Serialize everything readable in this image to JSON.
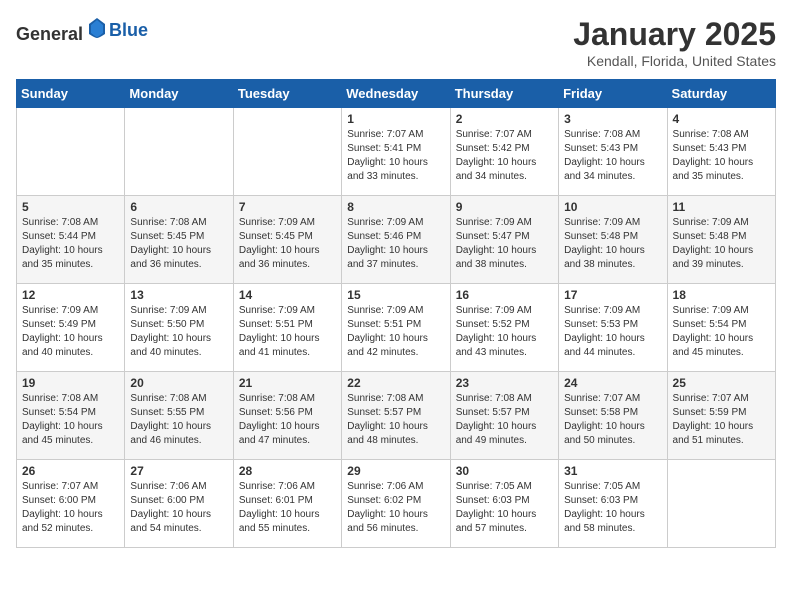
{
  "header": {
    "logo_general": "General",
    "logo_blue": "Blue",
    "title": "January 2025",
    "subtitle": "Kendall, Florida, United States"
  },
  "days_of_week": [
    "Sunday",
    "Monday",
    "Tuesday",
    "Wednesday",
    "Thursday",
    "Friday",
    "Saturday"
  ],
  "weeks": [
    [
      {
        "day": "",
        "sunrise": "",
        "sunset": "",
        "daylight": "",
        "empty": true
      },
      {
        "day": "",
        "sunrise": "",
        "sunset": "",
        "daylight": "",
        "empty": true
      },
      {
        "day": "",
        "sunrise": "",
        "sunset": "",
        "daylight": "",
        "empty": true
      },
      {
        "day": "1",
        "sunrise": "Sunrise: 7:07 AM",
        "sunset": "Sunset: 5:41 PM",
        "daylight": "Daylight: 10 hours and 33 minutes."
      },
      {
        "day": "2",
        "sunrise": "Sunrise: 7:07 AM",
        "sunset": "Sunset: 5:42 PM",
        "daylight": "Daylight: 10 hours and 34 minutes."
      },
      {
        "day": "3",
        "sunrise": "Sunrise: 7:08 AM",
        "sunset": "Sunset: 5:43 PM",
        "daylight": "Daylight: 10 hours and 34 minutes."
      },
      {
        "day": "4",
        "sunrise": "Sunrise: 7:08 AM",
        "sunset": "Sunset: 5:43 PM",
        "daylight": "Daylight: 10 hours and 35 minutes."
      }
    ],
    [
      {
        "day": "5",
        "sunrise": "Sunrise: 7:08 AM",
        "sunset": "Sunset: 5:44 PM",
        "daylight": "Daylight: 10 hours and 35 minutes."
      },
      {
        "day": "6",
        "sunrise": "Sunrise: 7:08 AM",
        "sunset": "Sunset: 5:45 PM",
        "daylight": "Daylight: 10 hours and 36 minutes."
      },
      {
        "day": "7",
        "sunrise": "Sunrise: 7:09 AM",
        "sunset": "Sunset: 5:45 PM",
        "daylight": "Daylight: 10 hours and 36 minutes."
      },
      {
        "day": "8",
        "sunrise": "Sunrise: 7:09 AM",
        "sunset": "Sunset: 5:46 PM",
        "daylight": "Daylight: 10 hours and 37 minutes."
      },
      {
        "day": "9",
        "sunrise": "Sunrise: 7:09 AM",
        "sunset": "Sunset: 5:47 PM",
        "daylight": "Daylight: 10 hours and 38 minutes."
      },
      {
        "day": "10",
        "sunrise": "Sunrise: 7:09 AM",
        "sunset": "Sunset: 5:48 PM",
        "daylight": "Daylight: 10 hours and 38 minutes."
      },
      {
        "day": "11",
        "sunrise": "Sunrise: 7:09 AM",
        "sunset": "Sunset: 5:48 PM",
        "daylight": "Daylight: 10 hours and 39 minutes."
      }
    ],
    [
      {
        "day": "12",
        "sunrise": "Sunrise: 7:09 AM",
        "sunset": "Sunset: 5:49 PM",
        "daylight": "Daylight: 10 hours and 40 minutes."
      },
      {
        "day": "13",
        "sunrise": "Sunrise: 7:09 AM",
        "sunset": "Sunset: 5:50 PM",
        "daylight": "Daylight: 10 hours and 40 minutes."
      },
      {
        "day": "14",
        "sunrise": "Sunrise: 7:09 AM",
        "sunset": "Sunset: 5:51 PM",
        "daylight": "Daylight: 10 hours and 41 minutes."
      },
      {
        "day": "15",
        "sunrise": "Sunrise: 7:09 AM",
        "sunset": "Sunset: 5:51 PM",
        "daylight": "Daylight: 10 hours and 42 minutes."
      },
      {
        "day": "16",
        "sunrise": "Sunrise: 7:09 AM",
        "sunset": "Sunset: 5:52 PM",
        "daylight": "Daylight: 10 hours and 43 minutes."
      },
      {
        "day": "17",
        "sunrise": "Sunrise: 7:09 AM",
        "sunset": "Sunset: 5:53 PM",
        "daylight": "Daylight: 10 hours and 44 minutes."
      },
      {
        "day": "18",
        "sunrise": "Sunrise: 7:09 AM",
        "sunset": "Sunset: 5:54 PM",
        "daylight": "Daylight: 10 hours and 45 minutes."
      }
    ],
    [
      {
        "day": "19",
        "sunrise": "Sunrise: 7:08 AM",
        "sunset": "Sunset: 5:54 PM",
        "daylight": "Daylight: 10 hours and 45 minutes."
      },
      {
        "day": "20",
        "sunrise": "Sunrise: 7:08 AM",
        "sunset": "Sunset: 5:55 PM",
        "daylight": "Daylight: 10 hours and 46 minutes."
      },
      {
        "day": "21",
        "sunrise": "Sunrise: 7:08 AM",
        "sunset": "Sunset: 5:56 PM",
        "daylight": "Daylight: 10 hours and 47 minutes."
      },
      {
        "day": "22",
        "sunrise": "Sunrise: 7:08 AM",
        "sunset": "Sunset: 5:57 PM",
        "daylight": "Daylight: 10 hours and 48 minutes."
      },
      {
        "day": "23",
        "sunrise": "Sunrise: 7:08 AM",
        "sunset": "Sunset: 5:57 PM",
        "daylight": "Daylight: 10 hours and 49 minutes."
      },
      {
        "day": "24",
        "sunrise": "Sunrise: 7:07 AM",
        "sunset": "Sunset: 5:58 PM",
        "daylight": "Daylight: 10 hours and 50 minutes."
      },
      {
        "day": "25",
        "sunrise": "Sunrise: 7:07 AM",
        "sunset": "Sunset: 5:59 PM",
        "daylight": "Daylight: 10 hours and 51 minutes."
      }
    ],
    [
      {
        "day": "26",
        "sunrise": "Sunrise: 7:07 AM",
        "sunset": "Sunset: 6:00 PM",
        "daylight": "Daylight: 10 hours and 52 minutes."
      },
      {
        "day": "27",
        "sunrise": "Sunrise: 7:06 AM",
        "sunset": "Sunset: 6:00 PM",
        "daylight": "Daylight: 10 hours and 54 minutes."
      },
      {
        "day": "28",
        "sunrise": "Sunrise: 7:06 AM",
        "sunset": "Sunset: 6:01 PM",
        "daylight": "Daylight: 10 hours and 55 minutes."
      },
      {
        "day": "29",
        "sunrise": "Sunrise: 7:06 AM",
        "sunset": "Sunset: 6:02 PM",
        "daylight": "Daylight: 10 hours and 56 minutes."
      },
      {
        "day": "30",
        "sunrise": "Sunrise: 7:05 AM",
        "sunset": "Sunset: 6:03 PM",
        "daylight": "Daylight: 10 hours and 57 minutes."
      },
      {
        "day": "31",
        "sunrise": "Sunrise: 7:05 AM",
        "sunset": "Sunset: 6:03 PM",
        "daylight": "Daylight: 10 hours and 58 minutes."
      },
      {
        "day": "",
        "sunrise": "",
        "sunset": "",
        "daylight": "",
        "empty": true
      }
    ]
  ]
}
